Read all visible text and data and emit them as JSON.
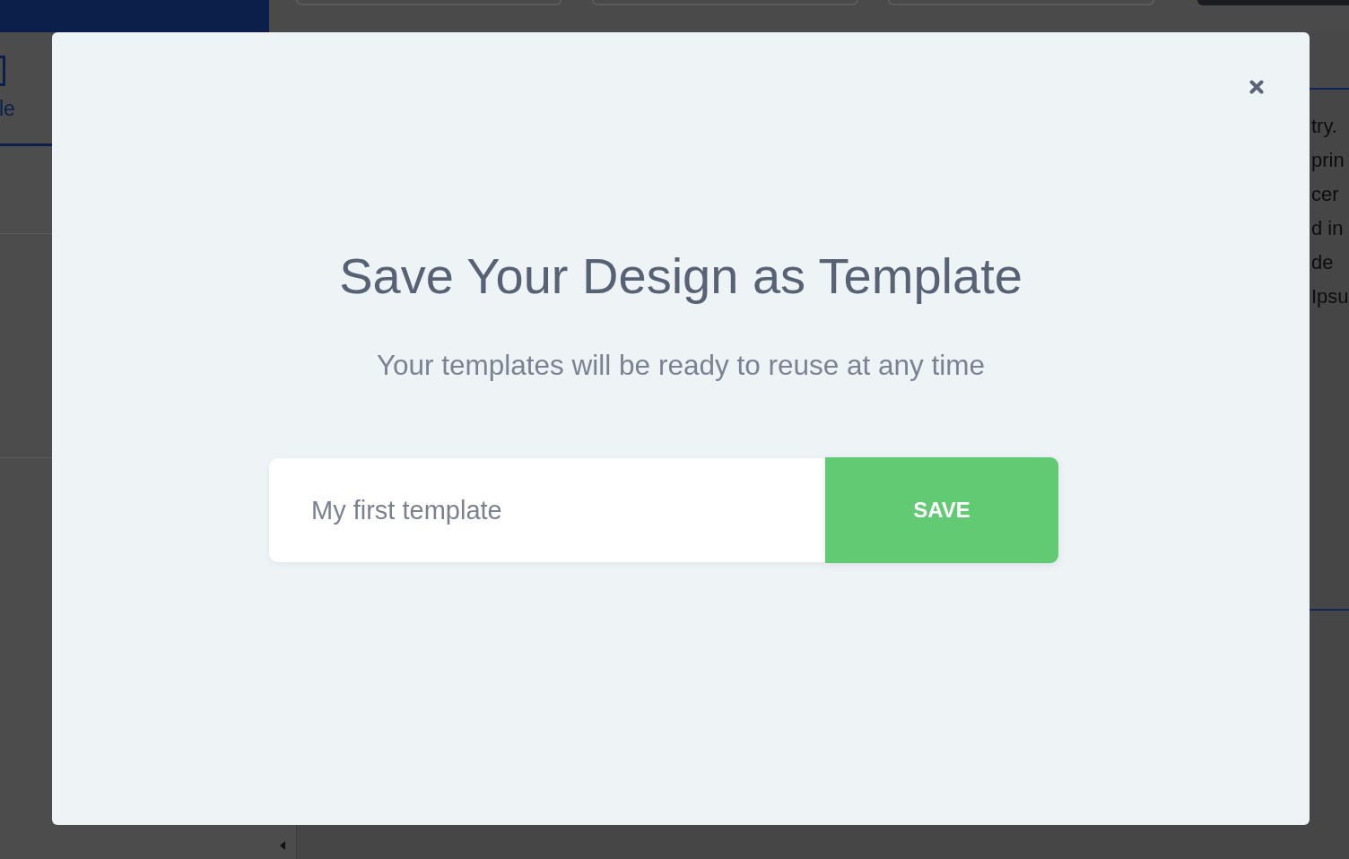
{
  "background": {
    "left_panel": {
      "tab": {
        "label": "le",
        "selected": true
      }
    },
    "content_lines": [
      "try.",
      "prin",
      "cer",
      "d in",
      "de",
      "Ipsu"
    ]
  },
  "dialog": {
    "title": "Save Your Design as Template",
    "subtitle": "Your templates will be ready to reuse at any time",
    "name_field": {
      "placeholder": "My first template"
    },
    "save_button": {
      "label": "SAVE"
    }
  }
}
